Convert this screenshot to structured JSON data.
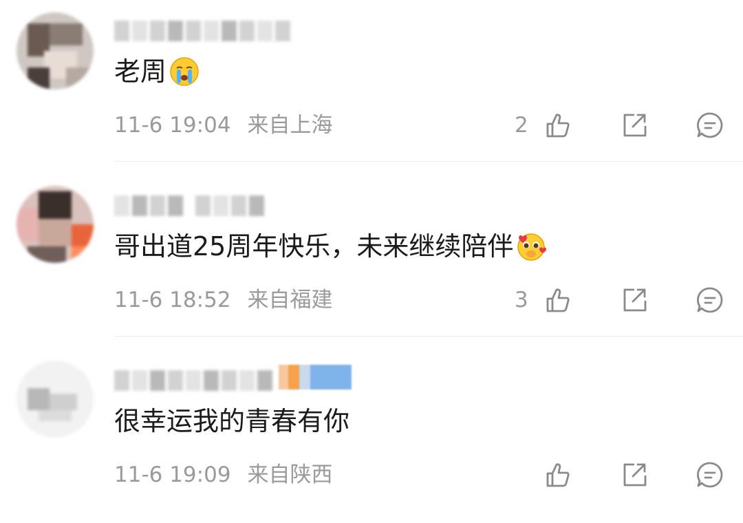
{
  "comments": [
    {
      "text": "老周",
      "emoji": "crying-face",
      "date": "11-6 19:04",
      "location": "来自上海",
      "likes": "2"
    },
    {
      "text": "哥出道25周年快乐，未来继续陪伴",
      "emoji": "pleading-face-hearts",
      "date": "11-6 18:52",
      "location": "来自福建",
      "likes": "3"
    },
    {
      "text": "很幸运我的青春有你",
      "emoji": "",
      "date": "11-6 19:09",
      "location": "来自陕西",
      "likes": ""
    }
  ],
  "icons": {
    "like": "thumbs-up-icon",
    "share": "share-icon",
    "reply": "comment-icon"
  },
  "colors": {
    "text": "#1b1b1b",
    "meta": "#9a9a9a",
    "icon": "#8a8a8a",
    "divider": "#ececec"
  }
}
